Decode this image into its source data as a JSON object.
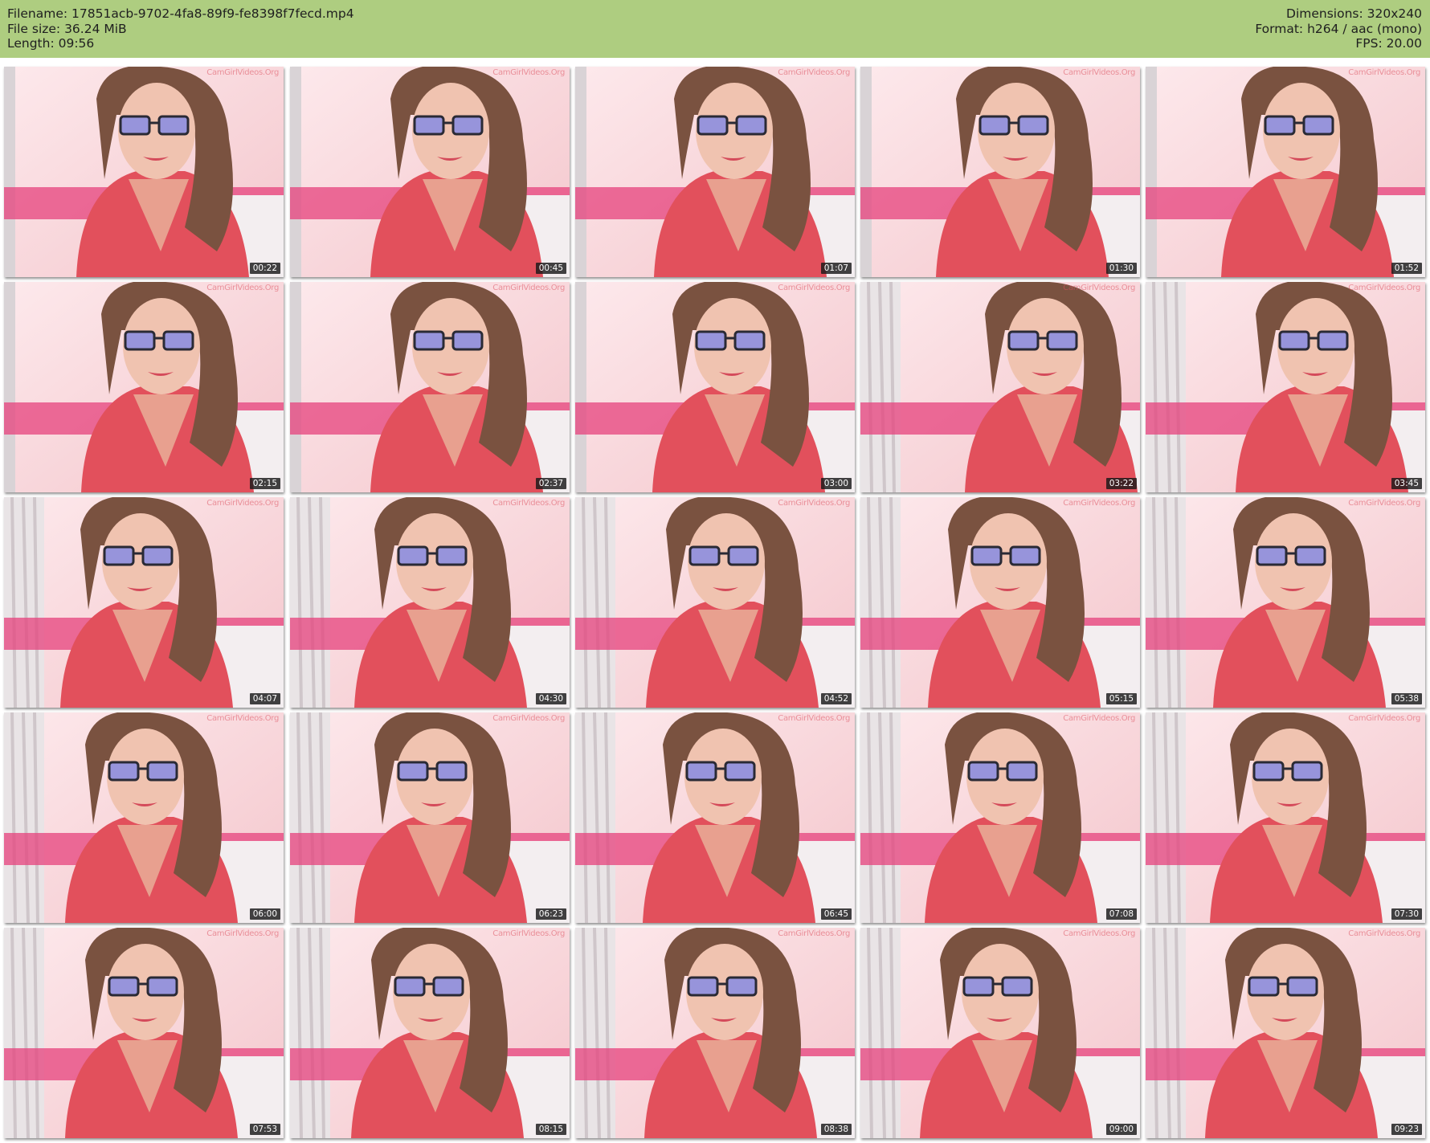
{
  "header": {
    "filename_label": "Filename: 17851acb-9702-4fa8-89f9-fe8398f7fecd.mp4",
    "filesize_label": "File size: 36.24 MiB",
    "length_label": "Length: 09:56",
    "dimensions_label": "Dimensions: 320x240",
    "format_label": "Format: h264 / aac (mono)",
    "fps_label": "FPS: 20.00"
  },
  "colors": {
    "header_bg": "#aecd80",
    "wall": "#f4c6cc",
    "robe": "#e2505c",
    "hair": "#7a5240",
    "glasses_lens": "#4f6dff",
    "timestamp_bg": "#191919"
  },
  "watermark_text": "CamGirlVideos.Org",
  "thumbnails": [
    {
      "time": "00:22"
    },
    {
      "time": "00:45"
    },
    {
      "time": "01:07"
    },
    {
      "time": "01:30"
    },
    {
      "time": "01:52"
    },
    {
      "time": "02:15"
    },
    {
      "time": "02:37"
    },
    {
      "time": "03:00"
    },
    {
      "time": "03:22"
    },
    {
      "time": "03:45"
    },
    {
      "time": "04:07"
    },
    {
      "time": "04:30"
    },
    {
      "time": "04:52"
    },
    {
      "time": "05:15"
    },
    {
      "time": "05:38"
    },
    {
      "time": "06:00"
    },
    {
      "time": "06:23"
    },
    {
      "time": "06:45"
    },
    {
      "time": "07:08"
    },
    {
      "time": "07:30"
    },
    {
      "time": "07:53"
    },
    {
      "time": "08:15"
    },
    {
      "time": "08:38"
    },
    {
      "time": "09:00"
    },
    {
      "time": "09:23"
    }
  ]
}
